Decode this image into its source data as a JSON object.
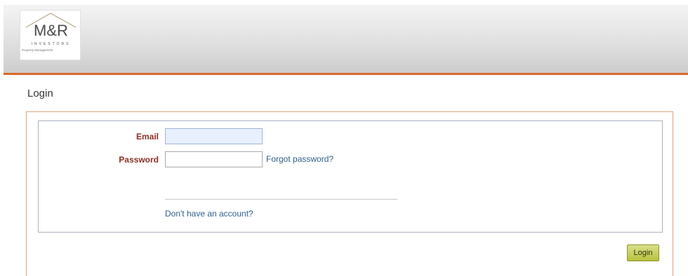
{
  "header": {
    "logo": {
      "mark": "M&R",
      "subtitle": "INVESTORS",
      "tagline": "Property Management"
    },
    "accent_color": "#d9692a"
  },
  "page": {
    "title": "Login"
  },
  "form": {
    "email_label": "Email",
    "email_value": "",
    "password_label": "Password",
    "password_value": "",
    "forgot_link": "Forgot password?",
    "no_account_link": "Don't have an account?",
    "login_button": "Login"
  },
  "colors": {
    "label_color": "#8b2f23",
    "link_color": "#2f5f8c",
    "button_color": "#b8c23c",
    "panel_border": "#e0a07c"
  }
}
